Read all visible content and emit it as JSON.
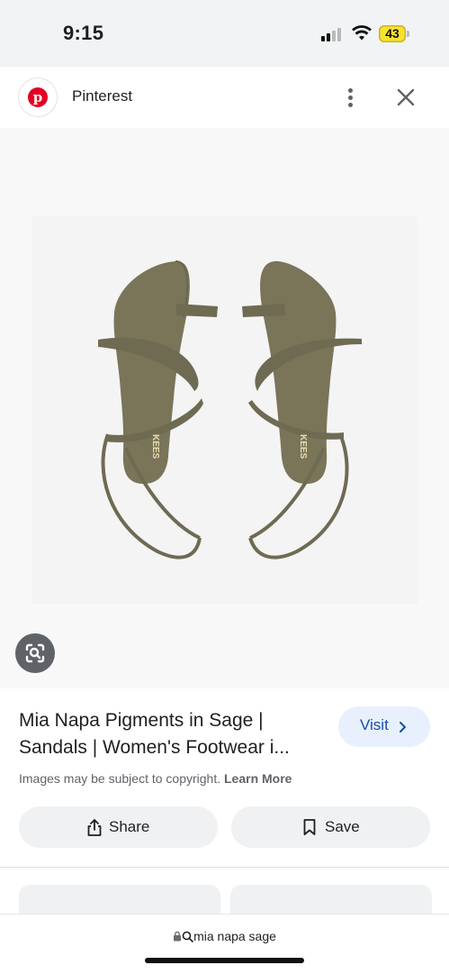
{
  "status_bar": {
    "time": "9:15",
    "battery_level": "43",
    "battery_color": "#f7e22e"
  },
  "site_header": {
    "logo_icon": "pinterest-logo",
    "site_name": "Pinterest",
    "more_icon": "more-vertical-icon",
    "close_icon": "close-icon",
    "brand_color": "#e60023"
  },
  "image": {
    "subject": "sandals",
    "lens_icon": "lens-search-icon",
    "product_color": "#7a7459"
  },
  "result": {
    "title": "Mia Napa Pigments in Sage | Sandals | Women's Footwear i...",
    "visit_label": "Visit",
    "visit_icon": "chevron-right-icon",
    "copyright_text": "Images may be subject to copyright.",
    "learn_more": "Learn More",
    "share_label": "Share",
    "share_icon": "share-icon",
    "save_label": "Save",
    "save_icon": "bookmark-icon",
    "accent_color": "#174ea6"
  },
  "url_bar": {
    "lock_icon": "lock-icon",
    "search_icon": "search-icon",
    "query": "mia napa sage"
  }
}
